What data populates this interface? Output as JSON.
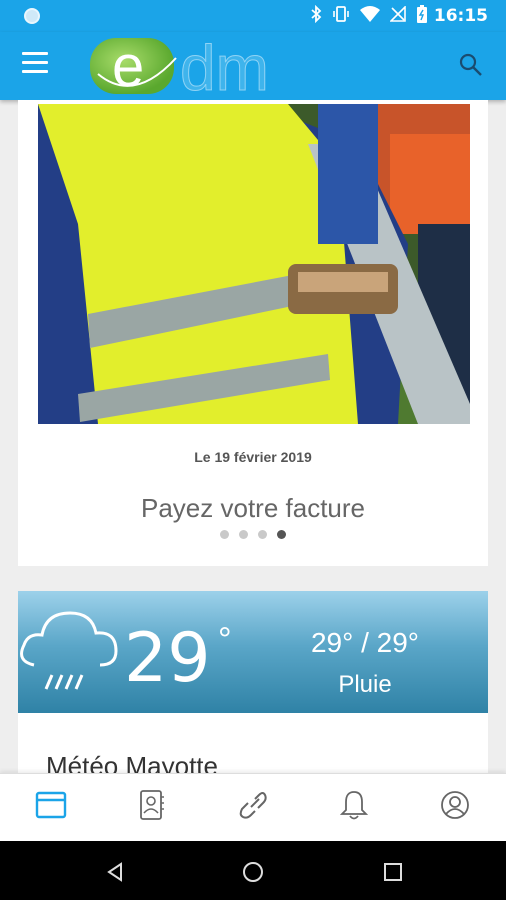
{
  "status_bar": {
    "time": "16:15",
    "icons": [
      "bluetooth-icon",
      "vibrate-icon",
      "wifi-icon",
      "no-signal-icon",
      "battery-icon"
    ]
  },
  "app_bar": {
    "logo_text": "edm",
    "colors": {
      "primary": "#1ba4e8",
      "logo_green": "#7cc242"
    }
  },
  "news": {
    "date": "Le 19 février 2019",
    "headline": "Payez votre facture",
    "carousel": {
      "count": 4,
      "active_index": 3
    }
  },
  "weather": {
    "temperature": "29",
    "degree_symbol": "°",
    "range": "29° / 29°",
    "condition": "Pluie",
    "icon": "rain-cloud-icon",
    "section_title": "Météo Mayotte"
  },
  "bottom_nav": {
    "tabs": [
      "home-card-icon",
      "contacts-icon",
      "link-icon",
      "bell-icon",
      "account-icon"
    ],
    "active_index": 0,
    "active_color": "#1ba4e8"
  },
  "system_nav": [
    "back-icon",
    "home-icon",
    "recents-icon"
  ]
}
